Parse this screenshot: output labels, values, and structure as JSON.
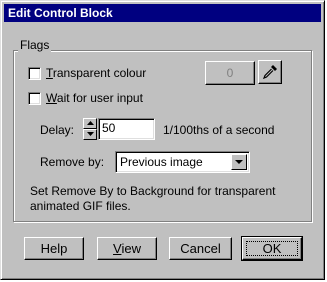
{
  "window": {
    "title": "Edit Control Block"
  },
  "flags": {
    "group_label": "Flags",
    "transparent_label_first": "T",
    "transparent_label_rest": "ransparent colour",
    "wait_label_first": "W",
    "wait_label_rest": "ait for user input",
    "colour_value": "0"
  },
  "delay": {
    "label": "Delay:",
    "value": "50",
    "unit": "1/100ths of a second"
  },
  "remove_by": {
    "label": "Remove by:",
    "selected": "Previous image"
  },
  "hint": "Set Remove By to Background for transparent animated GIF files.",
  "buttons": {
    "help": "Help",
    "view_first": "V",
    "view_rest": "iew",
    "cancel": "Cancel",
    "ok": "OK"
  }
}
